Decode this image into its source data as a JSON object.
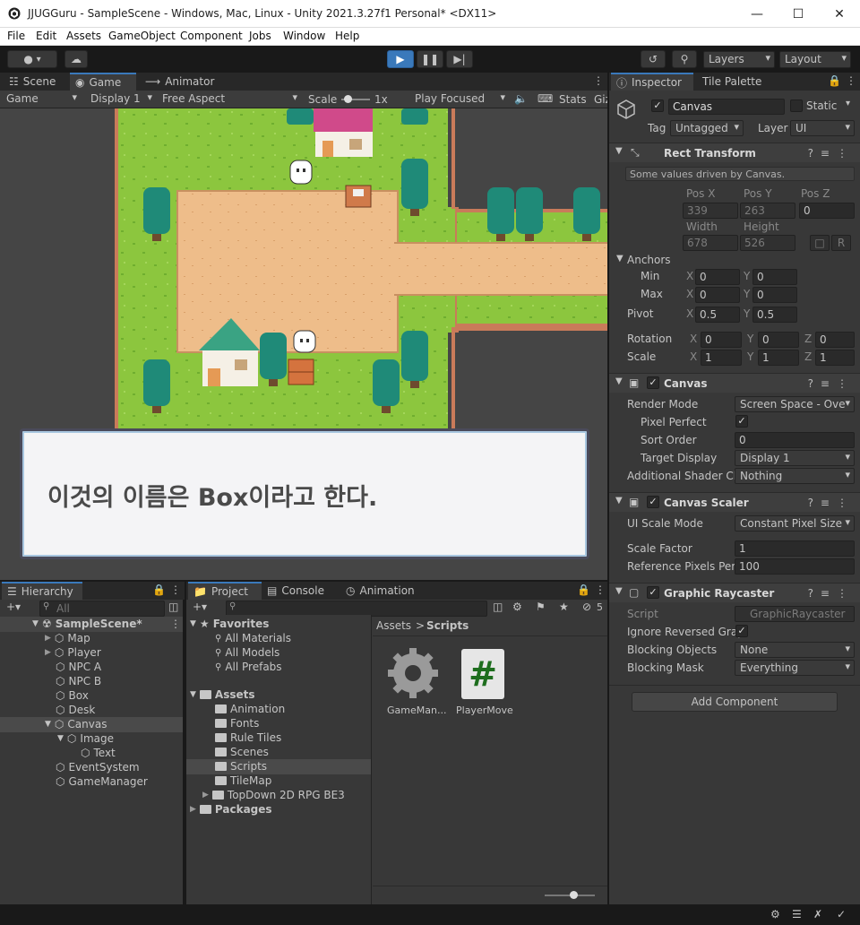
{
  "titlebar": {
    "title": "JJUGGuru - SampleScene - Windows, Mac, Linux - Unity 2021.3.27f1 Personal* <DX11>"
  },
  "menu": [
    "File",
    "Edit",
    "Assets",
    "GameObject",
    "Component",
    "Jobs",
    "Window",
    "Help"
  ],
  "toolbar": {
    "layers": "Layers",
    "layout": "Layout"
  },
  "scene_tabs": {
    "scene": "Scene",
    "game": "Game",
    "animator": "Animator"
  },
  "game_bar": {
    "mode": "Game",
    "display": "Display 1",
    "aspect": "Free Aspect",
    "scale_label": "Scale",
    "scale_value": "1x",
    "play_mode": "Play Focused",
    "stats": "Stats",
    "gizmos": "Giz"
  },
  "dialog": {
    "text": "이것의 이름은 Box이라고 한다."
  },
  "inspector": {
    "tabs": [
      "Inspector",
      "Tile Palette"
    ],
    "object_name": "Canvas",
    "static_label": "Static",
    "tag_label": "Tag",
    "tag_value": "Untagged",
    "layer_label": "Layer",
    "layer_value": "UI",
    "rect": {
      "title": "Rect Transform",
      "note": "Some values driven by Canvas.",
      "posx_label": "Pos X",
      "posy_label": "Pos Y",
      "posz_label": "Pos Z",
      "posx": "339",
      "posy": "263",
      "posz": "0",
      "width_label": "Width",
      "height_label": "Height",
      "width": "678",
      "height": "526",
      "anchors": "Anchors",
      "min": "Min",
      "max": "Max",
      "min_x": "0",
      "min_y": "0",
      "max_x": "0",
      "max_y": "0",
      "pivot": "Pivot",
      "pivot_x": "0.5",
      "pivot_y": "0.5",
      "rotation": "Rotation",
      "rot_x": "0",
      "rot_y": "0",
      "rot_z": "0",
      "scale": "Scale",
      "scale_x": "1",
      "scale_y": "1",
      "scale_z": "1",
      "x": "X",
      "y": "Y",
      "z": "Z",
      "r_btn": "R"
    },
    "canvas": {
      "title": "Canvas",
      "render_mode_label": "Render Mode",
      "render_mode": "Screen Space - Ove",
      "pixel_perfect": "Pixel Perfect",
      "sort_order_label": "Sort Order",
      "sort_order": "0",
      "target_display_label": "Target Display",
      "target_display": "Display 1",
      "shader_label": "Additional Shader Ch",
      "shader_value": "Nothing"
    },
    "scaler": {
      "title": "Canvas Scaler",
      "mode_label": "UI Scale Mode",
      "mode": "Constant Pixel Size",
      "factor_label": "Scale Factor",
      "factor": "1",
      "ref_label": "Reference Pixels Per",
      "ref": "100"
    },
    "raycaster": {
      "title": "Graphic Raycaster",
      "script_label": "Script",
      "script": "GraphicRaycaster",
      "ignore_label": "Ignore Reversed Grap",
      "blocking_label": "Blocking Objects",
      "blocking": "None",
      "mask_label": "Blocking Mask",
      "mask": "Everything"
    },
    "add_component": "Add Component"
  },
  "hierarchy": {
    "tab": "Hierarchy",
    "search": "All",
    "scene": "SampleScene*",
    "items": [
      "Map",
      "Player",
      "NPC A",
      "NPC B",
      "Box",
      "Desk",
      "Canvas",
      "Image",
      "Text",
      "EventSystem",
      "GameManager"
    ]
  },
  "project": {
    "tabs": [
      "Project",
      "Console",
      "Animation"
    ],
    "hidden_count": "5",
    "favorites": "Favorites",
    "fav_items": [
      "All Materials",
      "All Models",
      "All Prefabs"
    ],
    "assets": "Assets",
    "asset_items": [
      "Animation",
      "Fonts",
      "Rule Tiles",
      "Scenes",
      "Scripts",
      "TileMap",
      "TopDown 2D RPG BE3"
    ],
    "packages": "Packages",
    "breadcrumb_root": "Assets",
    "breadcrumb_sep": ">",
    "breadcrumb_current": "Scripts",
    "files": [
      "GameMan...",
      "PlayerMove"
    ],
    "hash_glyph": "#"
  },
  "colors": {
    "accent": "#3a79bb",
    "grass": "#8cc63e",
    "sand": "#eebd8a",
    "panel": "#383838"
  }
}
